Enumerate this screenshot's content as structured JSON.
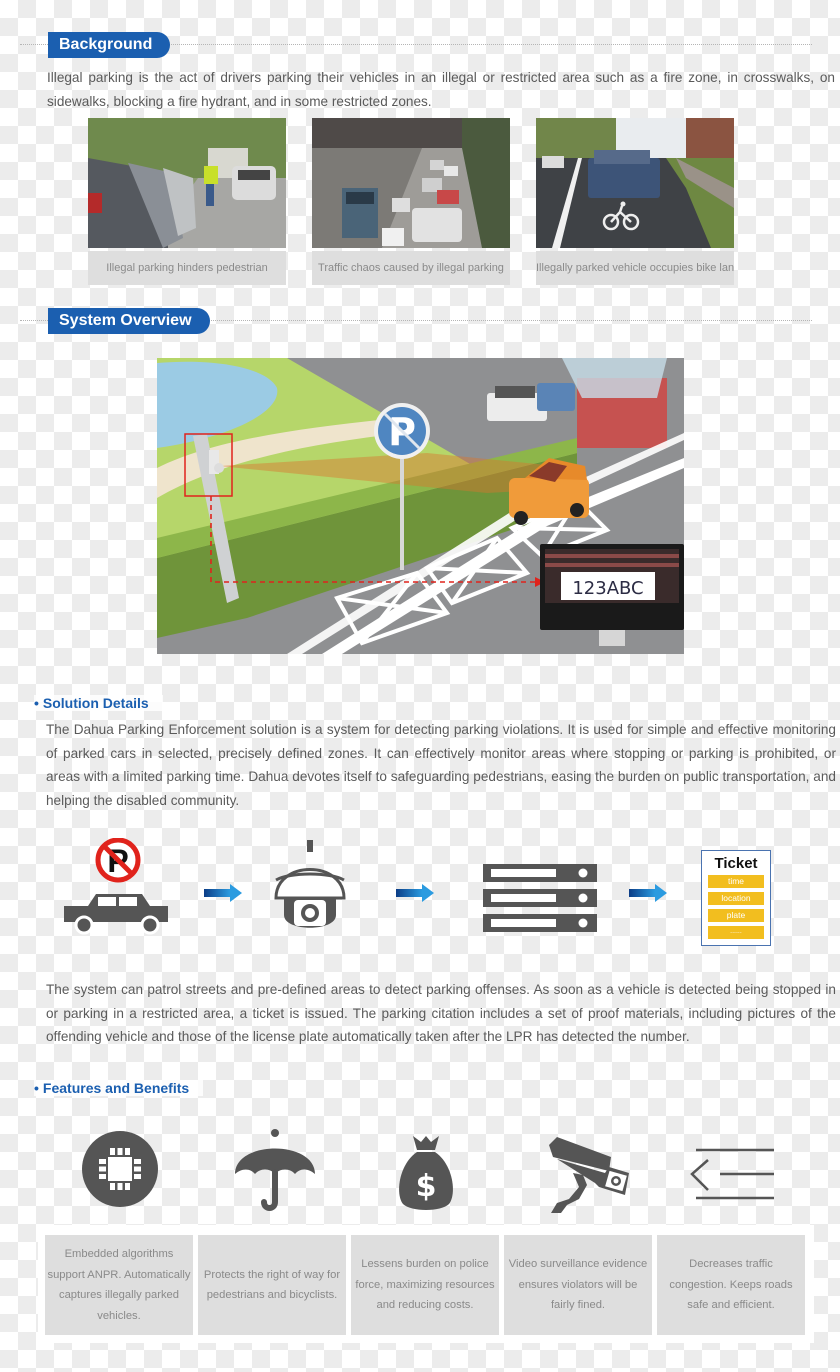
{
  "sections": {
    "background": {
      "title": "Background",
      "text": "Illegal parking is the act of drivers parking their vehicles in an illegal or restricted area such as a fire zone, in crosswalks, on sidewalks, blocking a fire hydrant, and in some restricted zones.",
      "photos": [
        {
          "caption": "Illegal parking hinders pedestrian",
          "subject": "cars parked along sidewalk with pedestrian walking in road"
        },
        {
          "caption": "Traffic chaos caused by illegal parking",
          "subject": "congested city street with buses and cars"
        },
        {
          "caption": "Illegally parked vehicle occupies bike lane",
          "subject": "pickup truck parked in marked bike lane"
        }
      ]
    },
    "overview": {
      "title": "System Overview",
      "illustration": {
        "plate_text": "123ABC",
        "sign": "no-parking-sign"
      }
    },
    "solution": {
      "title": "Solution Details",
      "text1": "The Dahua Parking Enforcement solution is a system for detecting parking violations. It is used for simple and effective monitoring of parked cars in selected, precisely defined zones. It can effectively monitor areas where stopping or parking is prohibited, or areas with a limited parking time. Dahua devotes itself to safeguarding pedestrians, easing the burden on public transportation, and helping the disabled community.",
      "flow": {
        "steps": [
          "no-parking-car-icon",
          "dome-camera-icon",
          "server-rack-icon",
          "ticket-icon"
        ],
        "ticket": {
          "title": "Ticket",
          "fields": [
            "time",
            "location",
            "plate",
            "......"
          ]
        }
      },
      "text2": "The system can patrol streets and pre-defined areas to detect parking offenses. As soon as a vehicle is detected being stopped in or parking in a restricted area, a ticket is issued. The parking citation includes a set of proof materials, including pictures of the offending vehicle and those of the license plate automatically taken after the LPR has detected the number."
    },
    "features": {
      "title": "Features and Benefits",
      "items": [
        {
          "icon": "chip-icon",
          "text": "Embedded algorithms support ANPR. Automatically captures illegally parked vehicles."
        },
        {
          "icon": "umbrella-icon",
          "text": "Protects the right of way for pedestrians and bicyclists."
        },
        {
          "icon": "money-bag-icon",
          "text": "Lessens burden on police force, maximizing resources and reducing costs."
        },
        {
          "icon": "cctv-camera-icon",
          "text": "Video surveillance evidence ensures violators will be fairly fined."
        },
        {
          "icon": "collapse-menu-icon",
          "text": "Decreases traffic congestion. Keeps roads safe and efficient."
        }
      ]
    }
  },
  "colors": {
    "brand_blue": "#1b5fb0",
    "icon_gray": "#555555",
    "ticket_yellow": "#f2be1f",
    "alert_red": "#e0231c"
  }
}
